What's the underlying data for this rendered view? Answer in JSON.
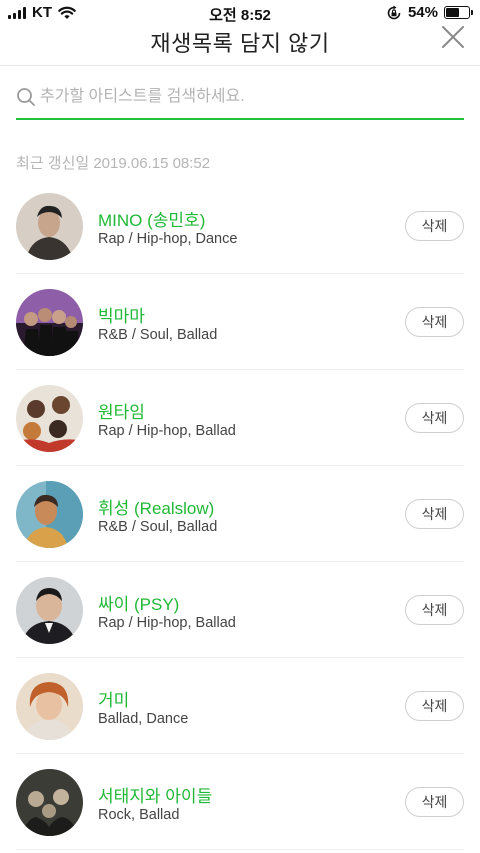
{
  "status_bar": {
    "carrier": "KT",
    "time": "오전 8:52",
    "battery": "54%"
  },
  "header": {
    "title": "재생목록 담지 않기"
  },
  "search": {
    "placeholder": "추가할 아티스트를 검색하세요.",
    "value": ""
  },
  "updated_text": "최근 갱신일 2019.06.15 08:52",
  "artists": [
    {
      "name": "MINO (송민호)",
      "genre": "Rap / Hip-hop, Dance",
      "delete_label": "삭제"
    },
    {
      "name": "빅마마",
      "genre": "R&B / Soul, Ballad",
      "delete_label": "삭제"
    },
    {
      "name": "원타임",
      "genre": "Rap / Hip-hop, Ballad",
      "delete_label": "삭제"
    },
    {
      "name": "휘성 (Realslow)",
      "genre": "R&B / Soul, Ballad",
      "delete_label": "삭제"
    },
    {
      "name": "싸이 (PSY)",
      "genre": "Rap / Hip-hop, Ballad",
      "delete_label": "삭제"
    },
    {
      "name": "거미",
      "genre": "Ballad, Dance",
      "delete_label": "삭제"
    },
    {
      "name": "서태지와 아이들",
      "genre": "Rock, Ballad",
      "delete_label": "삭제"
    }
  ],
  "colors": {
    "accent": "#22c13d",
    "artist_name": "#1fb936"
  }
}
